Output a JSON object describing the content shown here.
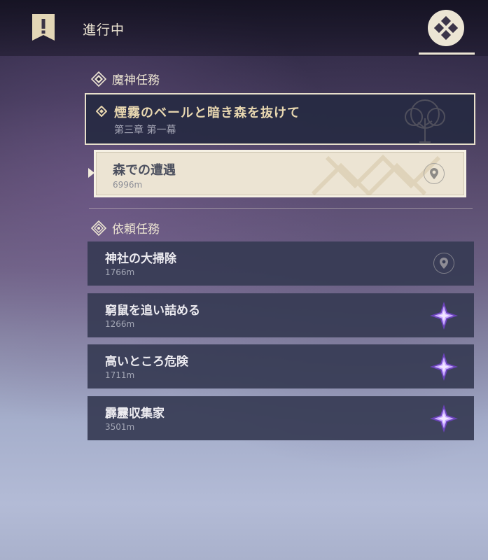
{
  "header": {
    "title": "進行中",
    "book_icon": "quest-book-icon",
    "nav_icon": "navigation-dpad-icon"
  },
  "archon": {
    "section_label": "魔神任務",
    "quest_title": "煙霧のベールと暗き森を抜けて",
    "quest_chapter": "第三章 第一幕",
    "subquest_title": "森での遭遇",
    "subquest_distance": "6996m"
  },
  "commission": {
    "section_label": "依頼任務",
    "quests": [
      {
        "title": "神社の大掃除",
        "distance": "1766m",
        "icon": "map-pin-icon"
      },
      {
        "title": "窮鼠を追い詰める",
        "distance": "1266m",
        "icon": "purple-star-icon"
      },
      {
        "title": "高いところ危険",
        "distance": "1711m",
        "icon": "purple-star-icon"
      },
      {
        "title": "霹靂収集家",
        "distance": "3501m",
        "icon": "purple-star-icon"
      }
    ]
  },
  "colors": {
    "accent_cream": "#ece4d3",
    "gold_text": "#e8d7b0",
    "row_bg": "#363b54",
    "star_purple": "#9b6fe0"
  }
}
